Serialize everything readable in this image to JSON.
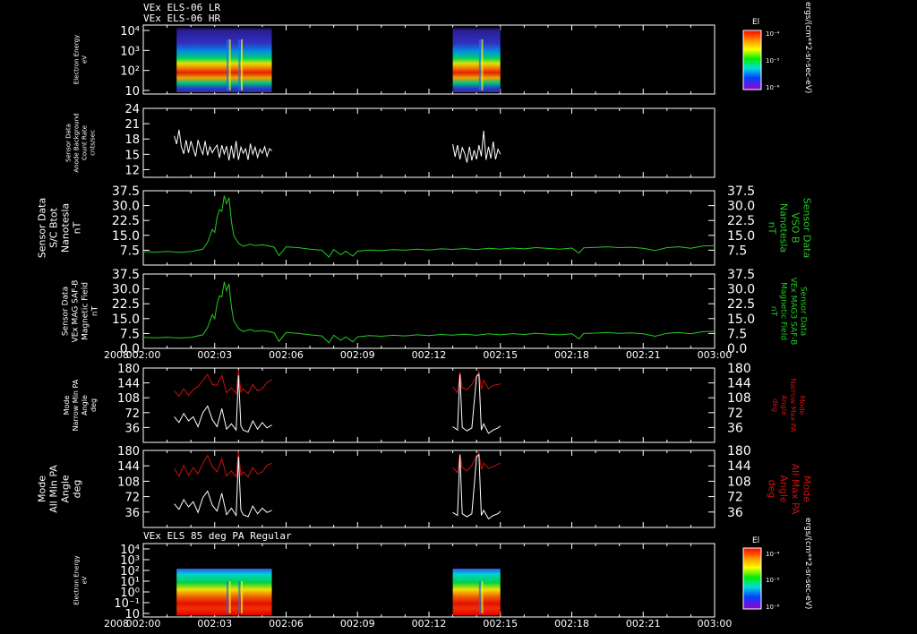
{
  "header": {
    "line1": "VEx ELS-06 LR",
    "line2": "VEx ELS-06 HR"
  },
  "colorbar_top": {
    "title": "El",
    "ticks": [
      "10⁻⁴",
      "10⁻⁵",
      "10⁻⁶"
    ],
    "side_label": "ergs/(cm**2-sr-sec-eV)"
  },
  "colorbar_bottom": {
    "title": "El",
    "ticks": [
      "10⁻⁴",
      "10⁻⁵",
      "10⁻⁶"
    ],
    "side_label": "ergs/(cm**2-sr-sec-eV)"
  },
  "bottom_panel_title": "VEx ELS 85 deg PA Regular",
  "colors": {
    "white": "#ffffff",
    "green": "#22cc22",
    "red": "#cc1111",
    "background": "#000000"
  },
  "chart_data": [
    {
      "type": "heatmap",
      "ylabel": "Electron Energy\neV",
      "y_ticks": [
        "10⁴",
        "10³",
        "10²",
        "10"
      ],
      "x_ticks": []
    },
    {
      "type": "line",
      "ylabel": "Sensor Data\nAnode Background\nCount Rate\ncnts/sec",
      "y_ticks": [
        "24",
        "21",
        "18",
        "15",
        "12"
      ],
      "ylim": [
        10.5,
        24
      ],
      "series": [
        {
          "color": "#ffffff",
          "x": [
            1.3,
            1.4,
            1.5,
            1.6,
            1.7,
            1.8,
            1.9,
            2.0,
            2.1,
            2.2,
            2.3,
            2.4,
            2.5,
            2.6,
            2.7,
            2.8,
            2.9,
            3.0,
            3.1,
            3.2,
            3.3,
            3.4,
            3.5,
            3.6,
            3.7,
            3.8,
            3.9,
            4.0,
            4.1,
            4.2,
            4.3,
            4.4,
            4.5,
            4.6,
            4.7,
            4.8,
            4.9,
            5.0,
            5.1,
            5.2,
            5.3,
            5.4
          ],
          "values": [
            18.6,
            17.0,
            19.8,
            16.5,
            15.1,
            17.8,
            15.3,
            17.6,
            16.1,
            14.6,
            17.8,
            16.2,
            15.0,
            17.6,
            14.8,
            16.5,
            15.3,
            16.2,
            16.8,
            14.3,
            16.8,
            15.1,
            16.6,
            13.8,
            16.7,
            14.2,
            17.6,
            13.9,
            16.4,
            15.2,
            16.1,
            13.9,
            17.1,
            15.0,
            16.4,
            14.4,
            16.0,
            15.2,
            16.5,
            14.6,
            16.1,
            15.7
          ]
        },
        {
          "color": "#ffffff",
          "x": [
            13.0,
            13.1,
            13.2,
            13.3,
            13.4,
            13.5,
            13.6,
            13.7,
            13.8,
            13.9,
            14.0,
            14.1,
            14.2,
            14.3,
            14.4,
            14.5,
            14.6,
            14.7,
            14.8,
            14.9,
            15.0
          ],
          "values": [
            17.0,
            14.5,
            16.8,
            14.0,
            16.3,
            15.2,
            13.4,
            16.5,
            13.8,
            15.8,
            14.0,
            16.8,
            14.6,
            19.6,
            13.9,
            16.5,
            14.2,
            17.5,
            14.0,
            16.0,
            15.0
          ]
        }
      ]
    },
    {
      "type": "line",
      "ylabel": "Sensor Data\nS/C Btot\nNanotesla\nnT",
      "ylabel_right": "Sensor Data\nVSO B\nNanotesla\nnT",
      "y_ticks": [
        "37.5",
        "30.0",
        "22.5",
        "15.0",
        "7.5"
      ],
      "ylim": [
        0,
        37.5
      ],
      "series": [
        {
          "color": "#22cc22",
          "x": [
            0.0,
            0.5,
            1.0,
            1.5,
            2.0,
            2.5,
            2.7,
            2.9,
            3.0,
            3.1,
            3.2,
            3.3,
            3.4,
            3.5,
            3.6,
            3.7,
            3.8,
            4.0,
            4.2,
            4.5,
            4.7,
            5.0,
            5.3,
            5.5,
            5.7,
            6.0,
            6.5,
            7.0,
            7.5,
            7.8,
            8.0,
            8.3,
            8.5,
            8.8,
            9.0,
            9.5,
            10.0,
            10.5,
            11.0,
            11.5,
            12.0,
            12.5,
            13.0,
            13.5,
            14.0,
            14.5,
            15.0,
            15.5,
            16.0,
            16.5,
            17.0,
            17.5,
            18.0,
            18.3,
            18.5,
            19.0,
            19.5,
            20.0,
            20.5,
            21.0,
            21.5,
            22.0,
            22.5,
            23.0,
            23.5,
            24.0
          ],
          "values": [
            6.8,
            6.5,
            6.9,
            6.4,
            6.8,
            8.0,
            11.5,
            18.0,
            16.5,
            24.0,
            28.0,
            27.0,
            35.0,
            31.0,
            34.0,
            22.0,
            15.0,
            11.0,
            9.5,
            10.5,
            9.8,
            10.2,
            9.6,
            9.0,
            4.8,
            9.2,
            8.8,
            8.0,
            7.5,
            4.0,
            7.8,
            5.2,
            7.0,
            4.5,
            7.0,
            7.6,
            7.3,
            7.8,
            7.5,
            8.0,
            7.6,
            8.2,
            7.9,
            8.3,
            7.8,
            8.5,
            8.0,
            8.6,
            8.2,
            8.8,
            8.4,
            8.0,
            8.6,
            6.0,
            8.7,
            8.9,
            9.2,
            8.8,
            9.0,
            8.5,
            7.3,
            8.8,
            9.2,
            8.5,
            9.6,
            9.8
          ]
        }
      ]
    },
    {
      "type": "line",
      "ylabel": "Sensor Data\nVEx MAG SAF-B\nMagnetic Field\nnT",
      "ylabel_right": "Sensor Data\nVEx MAG3 SAF-B\nMagnetic Field\nnT",
      "y_ticks": [
        "37.5",
        "30.0",
        "22.5",
        "15.0",
        "7.5",
        "0.0"
      ],
      "ylim": [
        0,
        37.5
      ],
      "x_ticks": [
        "002:00",
        "002:03",
        "002:06",
        "002:09",
        "002:12",
        "002:15",
        "002:18",
        "002:21",
        "003:00"
      ],
      "year_label": "2008",
      "series": [
        {
          "color": "#22cc22",
          "x": [
            0.0,
            0.5,
            1.0,
            1.5,
            2.0,
            2.5,
            2.7,
            2.9,
            3.0,
            3.1,
            3.2,
            3.3,
            3.4,
            3.5,
            3.6,
            3.7,
            3.8,
            4.0,
            4.2,
            4.5,
            4.7,
            5.0,
            5.3,
            5.5,
            5.7,
            6.0,
            6.5,
            7.0,
            7.5,
            7.8,
            8.0,
            8.3,
            8.5,
            8.8,
            9.0,
            9.5,
            10.0,
            10.5,
            11.0,
            11.5,
            12.0,
            12.5,
            13.0,
            13.5,
            14.0,
            14.5,
            15.0,
            15.5,
            16.0,
            16.5,
            17.0,
            17.5,
            18.0,
            18.3,
            18.5,
            19.0,
            19.5,
            20.0,
            20.5,
            21.0,
            21.5,
            22.0,
            22.5,
            23.0,
            23.5,
            24.0
          ],
          "values": [
            5.5,
            5.3,
            5.6,
            5.2,
            5.5,
            6.8,
            10.5,
            17.0,
            15.0,
            22.5,
            26.5,
            26.0,
            33.5,
            29.0,
            32.5,
            21.0,
            14.0,
            10.0,
            8.5,
            9.5,
            8.6,
            9.0,
            8.4,
            7.8,
            3.5,
            8.0,
            7.6,
            6.8,
            6.3,
            2.8,
            6.6,
            4.0,
            5.8,
            3.3,
            5.8,
            6.4,
            6.1,
            6.6,
            6.3,
            6.8,
            6.4,
            7.0,
            6.7,
            7.1,
            6.6,
            7.3,
            6.8,
            7.4,
            7.0,
            7.6,
            7.2,
            6.8,
            7.4,
            4.8,
            7.5,
            7.7,
            8.0,
            7.6,
            7.8,
            7.3,
            6.1,
            7.6,
            8.0,
            7.3,
            8.4,
            8.6
          ]
        }
      ]
    },
    {
      "type": "line",
      "ylabel": "Mode\nNarrow Min PA\nAngle\ndeg",
      "ylabel_right": "Mode\nNarrow Max PA\nAngle\ndeg",
      "y_ticks": [
        "180",
        "144",
        "108",
        "72",
        "36"
      ],
      "ylim": [
        0,
        180
      ],
      "series": [
        {
          "name": "Narrow Max PA",
          "color": "#cc1111",
          "x": [
            1.3,
            1.5,
            1.7,
            1.9,
            2.1,
            2.3,
            2.5,
            2.7,
            2.9,
            3.1,
            3.3,
            3.5,
            3.7,
            3.9,
            4.0,
            4.1,
            4.2,
            4.4,
            4.6,
            4.8,
            5.0,
            5.2,
            5.4
          ],
          "values": [
            125,
            112,
            130,
            114,
            128,
            135,
            150,
            165,
            140,
            138,
            162,
            120,
            132,
            118,
            175,
            122,
            130,
            118,
            140,
            125,
            130,
            145,
            152
          ]
        },
        {
          "name": "Narrow Min PA",
          "color": "#ffffff",
          "x": [
            1.3,
            1.5,
            1.7,
            1.9,
            2.1,
            2.3,
            2.5,
            2.7,
            2.9,
            3.1,
            3.3,
            3.5,
            3.7,
            3.9,
            4.0,
            4.1,
            4.2,
            4.4,
            4.6,
            4.8,
            5.0,
            5.2,
            5.4
          ],
          "values": [
            62,
            48,
            70,
            52,
            62,
            38,
            72,
            88,
            55,
            38,
            82,
            32,
            45,
            30,
            162,
            40,
            30,
            25,
            52,
            32,
            48,
            35,
            42
          ]
        },
        {
          "name": "Narrow Max PA",
          "color": "#cc1111",
          "x": [
            13.0,
            13.2,
            13.3,
            13.4,
            13.6,
            13.8,
            14.0,
            14.1,
            14.2,
            14.3,
            14.5,
            14.7,
            14.9,
            15.0
          ],
          "values": [
            135,
            120,
            170,
            132,
            128,
            140,
            160,
            172,
            128,
            150,
            130,
            138,
            140,
            142
          ]
        },
        {
          "name": "Narrow Min PA",
          "color": "#ffffff",
          "x": [
            13.0,
            13.2,
            13.3,
            13.4,
            13.6,
            13.8,
            14.0,
            14.1,
            14.2,
            14.3,
            14.5,
            14.7,
            14.9,
            15.0
          ],
          "values": [
            38,
            30,
            165,
            36,
            28,
            35,
            160,
            165,
            30,
            45,
            22,
            30,
            35,
            40
          ]
        }
      ]
    },
    {
      "type": "line",
      "ylabel": "Mode\nAll Min PA\nAngle\ndeg",
      "ylabel_right": "Mode\nAll Max PA\nAngle\ndeg",
      "y_ticks": [
        "180",
        "144",
        "108",
        "72",
        "36"
      ],
      "ylim": [
        0,
        180
      ],
      "series": [
        {
          "name": "All Max PA",
          "color": "#cc1111",
          "x": [
            1.3,
            1.5,
            1.7,
            1.9,
            2.1,
            2.3,
            2.5,
            2.7,
            2.9,
            3.1,
            3.3,
            3.5,
            3.7,
            3.9,
            4.0,
            4.1,
            4.2,
            4.4,
            4.6,
            4.8,
            5.0,
            5.2,
            5.4
          ],
          "values": [
            138,
            120,
            145,
            122,
            140,
            125,
            150,
            168,
            142,
            130,
            160,
            120,
            132,
            118,
            178,
            122,
            130,
            118,
            140,
            125,
            130,
            145,
            150
          ]
        },
        {
          "name": "All Min PA",
          "color": "#ffffff",
          "x": [
            1.3,
            1.5,
            1.7,
            1.9,
            2.1,
            2.3,
            2.5,
            2.7,
            2.9,
            3.1,
            3.3,
            3.5,
            3.7,
            3.9,
            4.0,
            4.1,
            4.2,
            4.4,
            4.6,
            4.8,
            5.0,
            5.2,
            5.4
          ],
          "values": [
            55,
            42,
            65,
            48,
            60,
            35,
            70,
            85,
            52,
            38,
            80,
            30,
            45,
            28,
            165,
            40,
            30,
            25,
            50,
            32,
            45,
            35,
            40
          ]
        },
        {
          "name": "All Max PA",
          "color": "#cc1111",
          "x": [
            13.0,
            13.2,
            13.3,
            13.4,
            13.6,
            13.8,
            14.0,
            14.1,
            14.2,
            14.3,
            14.5,
            14.7,
            14.9,
            15.0
          ],
          "values": [
            140,
            128,
            172,
            140,
            132,
            145,
            168,
            175,
            135,
            150,
            138,
            142,
            148,
            150
          ]
        },
        {
          "name": "All Min PA",
          "color": "#ffffff",
          "x": [
            13.0,
            13.2,
            13.3,
            13.4,
            13.6,
            13.8,
            14.0,
            14.1,
            14.2,
            14.3,
            14.5,
            14.7,
            14.9,
            15.0
          ],
          "values": [
            35,
            28,
            170,
            32,
            25,
            32,
            165,
            170,
            28,
            40,
            20,
            28,
            32,
            38
          ]
        }
      ]
    },
    {
      "type": "heatmap",
      "title": "VEx ELS 85 deg PA Regular",
      "ylabel": "Electron Energy\neV",
      "y_ticks": [
        "10⁴",
        "10³",
        "10²",
        "10¹",
        "10⁰",
        "10⁻¹",
        "10"
      ],
      "x_ticks": [
        "002:00",
        "002:03",
        "002:06",
        "002:09",
        "002:12",
        "002:15",
        "002:18",
        "002:21",
        "003:00"
      ],
      "year_label": "2008"
    }
  ]
}
